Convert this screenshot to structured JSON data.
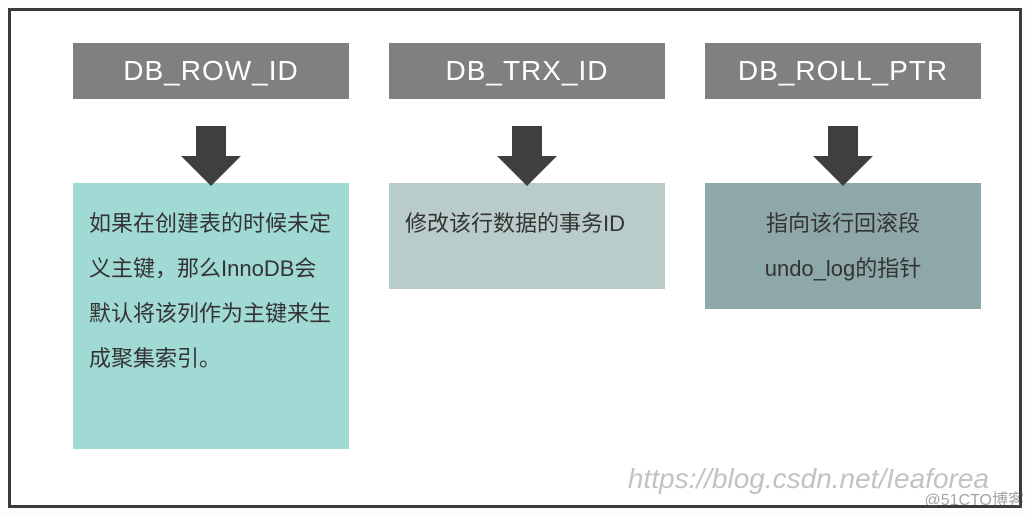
{
  "columns": [
    {
      "header": "DB_ROW_ID",
      "description": "如果在创建表的时候未定义主键，那么InnoDB会默认将该列作为主键来生成聚集索引。"
    },
    {
      "header": "DB_TRX_ID",
      "description": "修改该行数据的事务ID"
    },
    {
      "header": "DB_ROLL_PTR",
      "description": "指向该行回滚段undo_log的指针"
    }
  ],
  "watermark_main": "https://blog.csdn.net/Ieaforea",
  "watermark_corner": "@51CTO博客"
}
